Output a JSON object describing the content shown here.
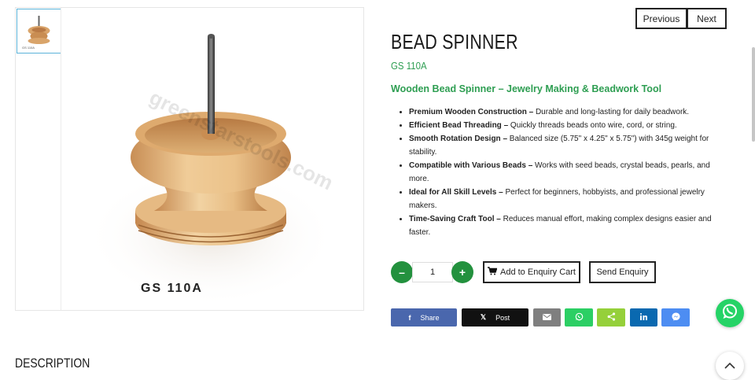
{
  "gallery": {
    "thumbnail_code": "GS 110A",
    "image_code_label": "GS 110A",
    "watermark": "greenstarstools.com"
  },
  "nav": {
    "previous": "Previous",
    "next": "Next"
  },
  "product": {
    "title": "BEAD SPINNER",
    "sku": "GS 110A",
    "subtitle": "Wooden Bead Spinner – Jewelry Making & Beadwork Tool",
    "features": [
      {
        "bold": "Premium Wooden Construction –",
        "text": " Durable and long-lasting for daily beadwork."
      },
      {
        "bold": "Efficient Bead Threading –",
        "text": " Quickly threads beads onto wire, cord, or string."
      },
      {
        "bold": "Smooth Rotation Design –",
        "text": " Balanced size (5.75\" x 4.25\" x 5.75\") with 345g weight for stability."
      },
      {
        "bold": "Compatible with Various Beads –",
        "text": " Works with seed beads, crystal beads, pearls, and more."
      },
      {
        "bold": "Ideal for All Skill Levels –",
        "text": " Perfect for beginners, hobbyists, and professional jewelry makers."
      },
      {
        "bold": "Time-Saving Craft Tool –",
        "text": " Reduces manual effort, making complex designs easier and faster."
      }
    ]
  },
  "quantity": {
    "minus": "–",
    "plus": "+",
    "value": "1"
  },
  "actions": {
    "add_to_cart": "Add to Enquiry Cart",
    "send_enquiry": "Send Enquiry"
  },
  "share": {
    "facebook": {
      "icon": "f",
      "label": "Share"
    },
    "twitter": {
      "icon": "𝕏",
      "label": "Post"
    }
  },
  "section": {
    "description": "DESCRIPTION"
  },
  "colors": {
    "accent_green": "#2e9e52",
    "button_green": "#23913e",
    "facebook": "#4a67ad",
    "whatsapp": "#25d366"
  }
}
